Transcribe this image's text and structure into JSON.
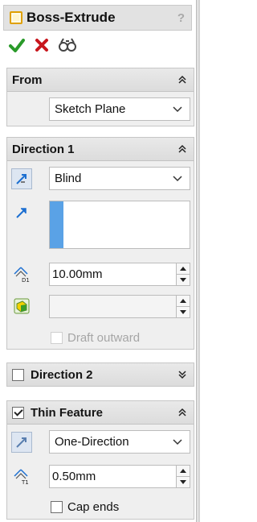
{
  "header": {
    "title": "Boss-Extrude",
    "help": "?"
  },
  "actions": {
    "ok": "ok-icon",
    "cancel": "cancel-icon",
    "preview": "preview-icon"
  },
  "from": {
    "title": "From",
    "start_condition": "Sketch Plane"
  },
  "direction1": {
    "title": "Direction 1",
    "end_condition": "Blind",
    "depth": "10.00mm",
    "draft_value": "",
    "draft_outward_label": "Draft outward"
  },
  "direction2": {
    "title": "Direction 2",
    "checked": false
  },
  "thin_feature": {
    "title": "Thin Feature",
    "checked": true,
    "type": "One-Direction",
    "thickness": "0.50mm",
    "cap_ends_label": "Cap ends"
  },
  "colors": {
    "accent_blue": "#1c6fd1",
    "check_green": "#2a9a2a",
    "cancel_red": "#c8161d",
    "feature_orange": "#e0a000"
  }
}
